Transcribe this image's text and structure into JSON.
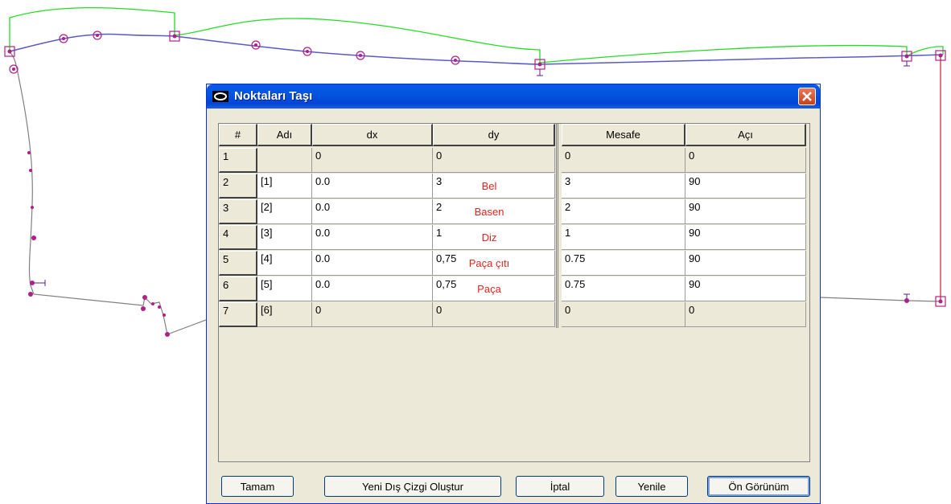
{
  "dialog": {
    "title": "Noktaları Taşı",
    "icon": "scissors-icon"
  },
  "table": {
    "columns": [
      "#",
      "Adı",
      "dx",
      "dy",
      "Mesafe",
      "Açı"
    ],
    "rows": [
      {
        "num": "1",
        "name": "",
        "dx": "0",
        "dy": "0",
        "label": "",
        "mesafe": "0",
        "aci": "0"
      },
      {
        "num": "2",
        "name": "[1]",
        "dx": "0.0",
        "dy": "3",
        "label": "Bel",
        "mesafe": "3",
        "aci": "90"
      },
      {
        "num": "3",
        "name": "[2]",
        "dx": "0.0",
        "dy": "2",
        "label": "Basen",
        "mesafe": "2",
        "aci": "90"
      },
      {
        "num": "4",
        "name": "[3]",
        "dx": "0.0",
        "dy": "1",
        "label": "Diz",
        "mesafe": "1",
        "aci": "90"
      },
      {
        "num": "5",
        "name": "[4]",
        "dx": "0.0",
        "dy": "0,75",
        "label": "Paça çıtı",
        "mesafe": "0.75",
        "aci": "90"
      },
      {
        "num": "6",
        "name": "[5]",
        "dx": "0.0",
        "dy": "0,75",
        "label": "Paça",
        "mesafe": "0.75",
        "aci": "90"
      },
      {
        "num": "7",
        "name": "[6]",
        "dx": "0",
        "dy": "0",
        "label": "",
        "mesafe": "0",
        "aci": "0"
      }
    ]
  },
  "buttons": {
    "ok": "Tamam",
    "new_outline": "Yeni Dış Çizgi Oluştur",
    "cancel": "İptal",
    "refresh": "Yenile",
    "preview": "Ön Görünüm"
  },
  "colors": {
    "pattern_line": "#5a5ac8",
    "guide_line": "#22dd22",
    "point": "#b0208a",
    "label_text": "#e8221b",
    "vertical_red": "#c8202a"
  }
}
